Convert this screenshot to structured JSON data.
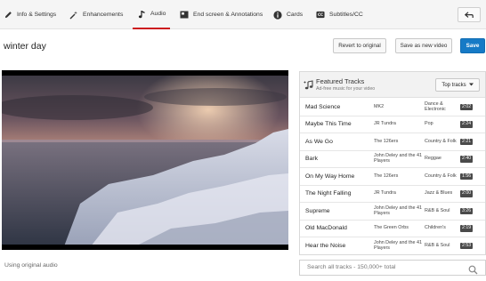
{
  "tabs": [
    {
      "label": "Info & Settings",
      "icon": "pencil-icon"
    },
    {
      "label": "Enhancements",
      "icon": "magic-wand-icon"
    },
    {
      "label": "Audio",
      "icon": "music-note-icon",
      "active": true
    },
    {
      "label": "End screen & Annotations",
      "icon": "end-screen-icon"
    },
    {
      "label": "Cards",
      "icon": "info-circle-icon"
    },
    {
      "label": "Subtitles/CC",
      "icon": "cc-icon"
    }
  ],
  "header": {
    "title": "winter day",
    "revert_label": "Revert to original",
    "save_new_label": "Save as new video",
    "save_label": "Save"
  },
  "audio_status": "Using original audio",
  "featured": {
    "title": "Featured Tracks",
    "subtitle": "Ad-free music for your video",
    "sort_label": "Top tracks"
  },
  "tracks": [
    {
      "title": "Mad Science",
      "artist": "MK2",
      "genre": "Dance & Electronic",
      "duration": "2:02"
    },
    {
      "title": "Maybe This Time",
      "artist": "JR Tundra",
      "genre": "Pop",
      "duration": "2:24"
    },
    {
      "title": "As We Go",
      "artist": "The 126ers",
      "genre": "Country & Folk",
      "duration": "2:21"
    },
    {
      "title": "Bark",
      "artist": "John Deley and the 41 Players",
      "genre": "Reggae",
      "duration": "2:40"
    },
    {
      "title": "On My Way Home",
      "artist": "The 126ers",
      "genre": "Country & Folk",
      "duration": "1:56"
    },
    {
      "title": "The Night Falling",
      "artist": "JR Tundra",
      "genre": "Jazz & Blues",
      "duration": "2:00"
    },
    {
      "title": "Supreme",
      "artist": "John Deley and the 41 Players",
      "genre": "R&B & Soul",
      "duration": "3:26"
    },
    {
      "title": "Old MacDonald",
      "artist": "The Green Orbs",
      "genre": "Children's",
      "duration": "2:19"
    },
    {
      "title": "Hear the Noise",
      "artist": "John Deley and the 41 Players",
      "genre": "R&B & Soul",
      "duration": "2:53"
    }
  ],
  "search": {
    "placeholder": "Search all tracks - 150,000+ total"
  },
  "colors": {
    "accent_red": "#cc181e",
    "save_blue": "#167ac6"
  }
}
